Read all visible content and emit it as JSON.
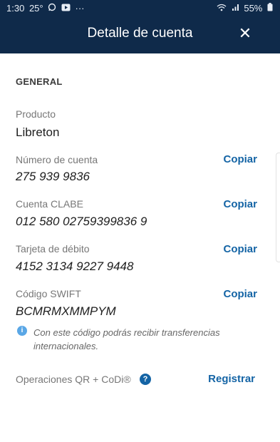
{
  "status_bar": {
    "time": "1:30",
    "temperature": "25°",
    "whatsapp_icon": "whatsapp-icon",
    "battery": "55%"
  },
  "header": {
    "title": "Detalle de cuenta",
    "close_label": "✕"
  },
  "section": {
    "title": "GENERAL"
  },
  "fields": [
    {
      "label": "Producto",
      "value": "Libreton"
    },
    {
      "label": "Número de cuenta",
      "value": "275 939 9836",
      "action": "Copiar"
    },
    {
      "label": "Cuenta CLABE",
      "value": "012 580 02759399836 9",
      "action": "Copiar"
    },
    {
      "label": "Tarjeta de débito",
      "value": "4152 3134 9227 9448",
      "action": "Copiar"
    },
    {
      "label": "Código SWIFT",
      "value": "BCMRMXMMPYM",
      "action": "Copiar"
    }
  ],
  "swift_info": {
    "icon": "i",
    "text": "Con este código podrás recibir transferencias internacionales."
  },
  "qr": {
    "label": "Operaciones QR + CoDi®",
    "help_icon": "?",
    "action": "Registrar"
  },
  "colors": {
    "header_bg": "#0f2a4a",
    "accent": "#1464a5",
    "info": "#5aa7e6"
  }
}
